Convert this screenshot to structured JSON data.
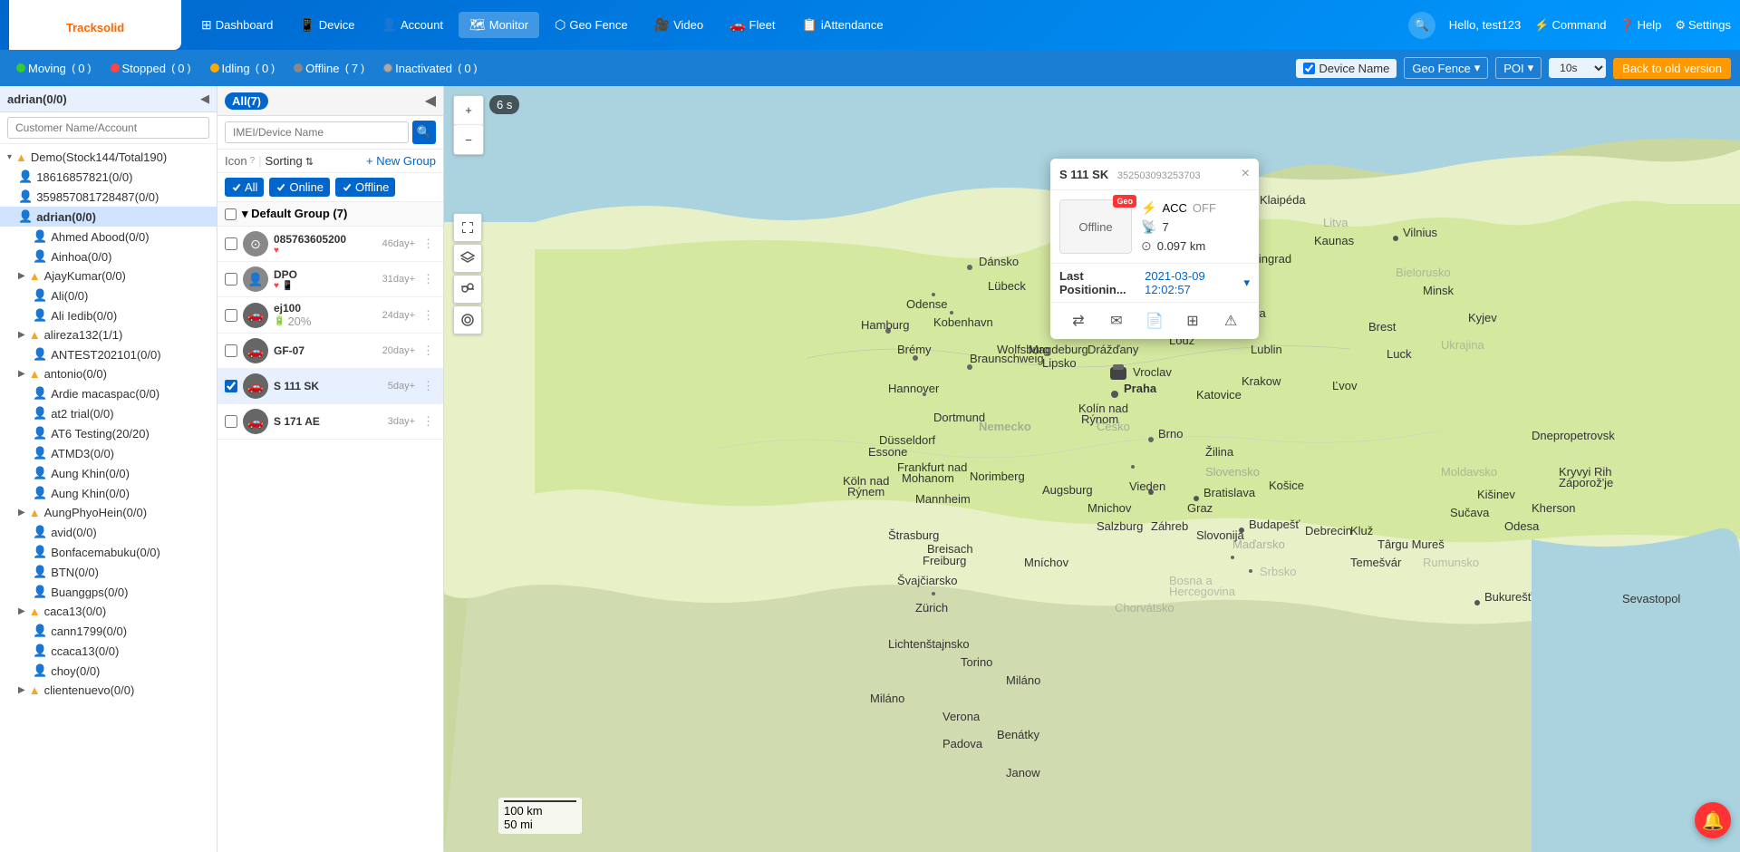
{
  "app": {
    "logo_text": "Track",
    "logo_accent": "solid"
  },
  "nav": {
    "items": [
      {
        "id": "dashboard",
        "label": "Dashboard",
        "icon": "⊞"
      },
      {
        "id": "device",
        "label": "Device",
        "icon": "📱"
      },
      {
        "id": "account",
        "label": "Account",
        "icon": "👤"
      },
      {
        "id": "monitor",
        "label": "Monitor",
        "icon": "🗺"
      },
      {
        "id": "geofence",
        "label": "Geo Fence",
        "icon": "⬡"
      },
      {
        "id": "video",
        "label": "Video",
        "icon": "🎥"
      },
      {
        "id": "fleet",
        "label": "Fleet",
        "icon": "🚗"
      },
      {
        "id": "iattendance",
        "label": "iAttendance",
        "icon": "📋"
      }
    ],
    "hello_label": "Hello,",
    "username": "test123",
    "command_label": "Command",
    "help_label": "Help",
    "settings_label": "Settings"
  },
  "status_bar": {
    "moving_label": "Moving",
    "moving_count": "0",
    "stopped_label": "Stopped",
    "stopped_count": "0",
    "idling_label": "Idling",
    "idling_count": "0",
    "offline_label": "Offline",
    "offline_count": "7",
    "inactivated_label": "Inactivated",
    "inactivated_count": "0",
    "device_name_label": "Device Name",
    "geo_fence_label": "Geo Fence",
    "poi_label": "POI",
    "interval_value": "10s",
    "back_old_label": "Back to old version"
  },
  "sidebar": {
    "account_title": "adrian(0/0)",
    "search_placeholder": "Customer Name/Account",
    "tree_items": [
      {
        "id": "demo",
        "label": "Demo(Stock144/Total190)",
        "level": 0,
        "type": "group",
        "has_arrow": true
      },
      {
        "id": "18616857821",
        "label": "18616857821(0/0)",
        "level": 1,
        "type": "person"
      },
      {
        "id": "35985708",
        "label": "35985708172848​7(0/0)",
        "level": 1,
        "type": "person"
      },
      {
        "id": "adrian",
        "label": "adrian(0/0)",
        "level": 1,
        "type": "person",
        "selected": true
      },
      {
        "id": "ahmed",
        "label": "Ahmed Abood(0/0)",
        "level": 2,
        "type": "person"
      },
      {
        "id": "ainhoa",
        "label": "Ainhoa(0/0)",
        "level": 2,
        "type": "person"
      },
      {
        "id": "ajaykumar",
        "label": "AjayKumar(0/0)",
        "level": 1,
        "type": "group"
      },
      {
        "id": "ali",
        "label": "Ali(0/0)",
        "level": 2,
        "type": "person"
      },
      {
        "id": "ali_iedib",
        "label": "Ali Iedib(0/0)",
        "level": 2,
        "type": "person"
      },
      {
        "id": "alireza",
        "label": "alireza132(1/1)",
        "level": 1,
        "type": "group"
      },
      {
        "id": "antest",
        "label": "ANTEST202101(0/0)",
        "level": 2,
        "type": "person"
      },
      {
        "id": "antonio",
        "label": "antonio(0/0)",
        "level": 1,
        "type": "group"
      },
      {
        "id": "ardie",
        "label": "Ardie macaspac(0/0)",
        "level": 2,
        "type": "person"
      },
      {
        "id": "at2",
        "label": "at2 trial(0/0)",
        "level": 2,
        "type": "person"
      },
      {
        "id": "at6",
        "label": "AT6 Testing(20/20)",
        "level": 2,
        "type": "person"
      },
      {
        "id": "atmd3",
        "label": "ATMD3(0/0)",
        "level": 2,
        "type": "person"
      },
      {
        "id": "aung_khin",
        "label": "Aung Khin(0/0)",
        "level": 2,
        "type": "person"
      },
      {
        "id": "aung_khin2",
        "label": "Aung Khin(0/0)",
        "level": 2,
        "type": "person"
      },
      {
        "id": "aungphyo",
        "label": "AungPhyoHein(0/0)",
        "level": 1,
        "type": "group"
      },
      {
        "id": "avid",
        "label": "avid(0/0)",
        "level": 2,
        "type": "person"
      },
      {
        "id": "bonfacemabuku",
        "label": "Bonfacemabuku(0/0)",
        "level": 2,
        "type": "person"
      },
      {
        "id": "btn",
        "label": "BTN(0/0)",
        "level": 2,
        "type": "person"
      },
      {
        "id": "buanggps",
        "label": "Buanggps(0/0)",
        "level": 2,
        "type": "person"
      },
      {
        "id": "caca13",
        "label": "caca13(0/0)",
        "level": 1,
        "type": "group"
      },
      {
        "id": "cann1799",
        "label": "cann1799(0/0)",
        "level": 2,
        "type": "person"
      },
      {
        "id": "ccaca13",
        "label": "ccaca13(0/0)",
        "level": 2,
        "type": "person"
      },
      {
        "id": "choy",
        "label": "choy(0/0)",
        "level": 2,
        "type": "person"
      },
      {
        "id": "clientenuevo",
        "label": "clientenuevo(0/0)",
        "level": 1,
        "type": "group"
      }
    ]
  },
  "device_panel": {
    "all_label": "All",
    "all_count": "7",
    "search_placeholder": "IMEI/Device Name",
    "icon_label": "Icon",
    "sorting_label": "Sorting",
    "new_group_label": "+ New Group",
    "all_filter": "All",
    "online_filter": "Online",
    "offline_filter": "Offline",
    "default_group_label": "▾ Default Group (7)",
    "devices": [
      {
        "id": "dev1",
        "name": "085763605200",
        "time": "46day+",
        "icon": "circle",
        "has_heart": true,
        "selected": false
      },
      {
        "id": "dev2",
        "name": "DPO",
        "time": "31day+",
        "icon": "person",
        "has_heart": true,
        "has_phone": true,
        "selected": false
      },
      {
        "id": "dev3",
        "name": "ej100",
        "time": "24day+",
        "icon": "car",
        "battery": "20%",
        "selected": false
      },
      {
        "id": "dev4",
        "name": "GF-07",
        "time": "20day+",
        "icon": "car",
        "selected": false
      },
      {
        "id": "dev5",
        "name": "S 111 SK",
        "time": "5day+",
        "icon": "car",
        "selected": true
      },
      {
        "id": "dev6",
        "name": "S 171 AE",
        "time": "3day+",
        "icon": "car",
        "selected": false
      }
    ]
  },
  "map": {
    "timer_label": "6 s",
    "zoom_in": "+",
    "zoom_out": "−",
    "scale_100km": "100 km",
    "scale_50mi": "50 mi"
  },
  "popup": {
    "title": "S 111 SK",
    "device_id": "352503093253703",
    "status": "Offline",
    "acc_label": "ACC",
    "acc_value": "OFF",
    "gps_value": "7",
    "distance_value": "0.097 km",
    "position_label": "Last Positionin...",
    "position_time": "2021-03-09 12:02:57",
    "geo_badge": "Geo"
  }
}
